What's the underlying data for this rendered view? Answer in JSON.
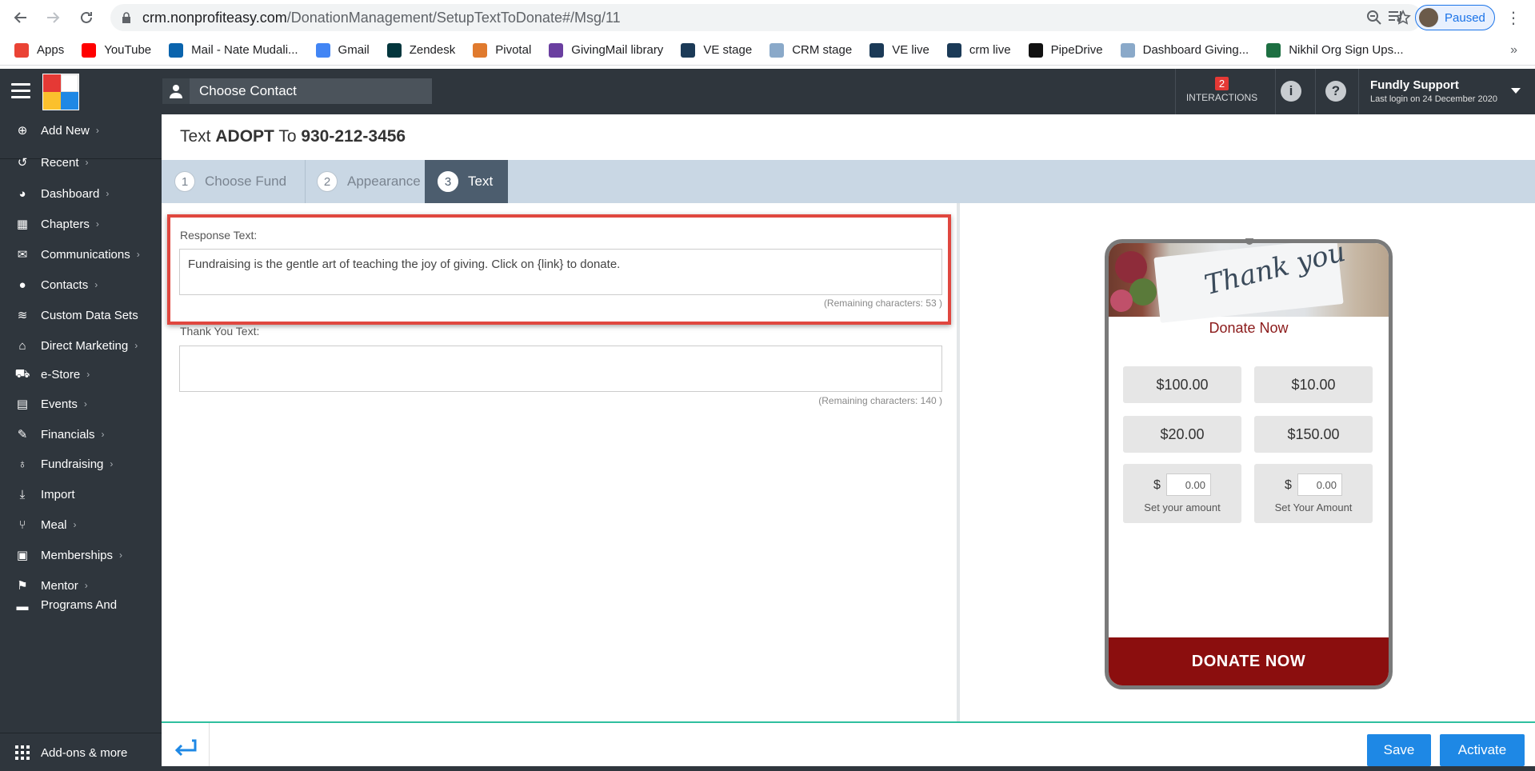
{
  "browser": {
    "url_host": "crm.nonprofiteasy.com",
    "url_path": "/DonationManagement/SetupTextToDonate#/Msg/11",
    "profile_status": "Paused"
  },
  "bookmarks": [
    {
      "label": "Apps",
      "icon": "apps-grid-icon",
      "color": "#ea4335"
    },
    {
      "label": "YouTube",
      "icon": "youtube-icon",
      "color": "#ff0000"
    },
    {
      "label": "Mail - Nate Mudali...",
      "icon": "outlook-icon",
      "color": "#0a64ad"
    },
    {
      "label": "Gmail",
      "icon": "google-icon",
      "color": "#4285f4"
    },
    {
      "label": "Zendesk",
      "icon": "zendesk-icon",
      "color": "#03363d"
    },
    {
      "label": "Pivotal",
      "icon": "pivotal-icon",
      "color": "#e07a2e"
    },
    {
      "label": "GivingMail library",
      "icon": "givingmail-icon",
      "color": "#6a3fa0"
    },
    {
      "label": "VE stage",
      "icon": "ve-icon",
      "color": "#1b3a57"
    },
    {
      "label": "CRM stage",
      "icon": "doc-icon",
      "color": "#8aa9c9"
    },
    {
      "label": "VE live",
      "icon": "ve-icon",
      "color": "#1b3a57"
    },
    {
      "label": "crm live",
      "icon": "ve-icon",
      "color": "#1b3a57"
    },
    {
      "label": "PipeDrive",
      "icon": "pipedrive-icon",
      "color": "#111111"
    },
    {
      "label": "Dashboard Giving...",
      "icon": "doc-icon",
      "color": "#8aa9c9"
    },
    {
      "label": "Nikhil Org Sign Ups...",
      "icon": "excel-icon",
      "color": "#1d6f42"
    }
  ],
  "header": {
    "choose_contact": "Choose Contact",
    "interactions_count": "2",
    "interactions_label": "INTERACTIONS",
    "user_name": "Fundly Support",
    "last_login": "Last login on 24 December 2020"
  },
  "sidebar": {
    "items": [
      {
        "label": "Add New",
        "icon": "plus-circle-icon"
      },
      {
        "label": "Recent",
        "icon": "history-icon"
      },
      {
        "label": "Dashboard",
        "icon": "palette-icon"
      },
      {
        "label": "Chapters",
        "icon": "grid-icon"
      },
      {
        "label": "Communications",
        "icon": "envelope-icon"
      },
      {
        "label": "Contacts",
        "icon": "user-icon"
      },
      {
        "label": "Custom Data Sets",
        "icon": "layers-icon"
      },
      {
        "label": "Direct Marketing",
        "icon": "building-icon"
      },
      {
        "label": "e-Store",
        "icon": "cart-icon"
      },
      {
        "label": "Events",
        "icon": "calendar-icon"
      },
      {
        "label": "Financials",
        "icon": "ticket-icon"
      },
      {
        "label": "Fundraising",
        "icon": "money-bag-icon"
      },
      {
        "label": "Import",
        "icon": "download-icon"
      },
      {
        "label": "Meal",
        "icon": "utensils-icon"
      },
      {
        "label": "Memberships",
        "icon": "id-card-icon"
      },
      {
        "label": "Mentor",
        "icon": "running-icon"
      },
      {
        "label": "Programs And",
        "icon": "folder-icon"
      }
    ],
    "addons": "Add-ons & more"
  },
  "page": {
    "title_prefix": "Text ",
    "keyword": "ADOPT",
    "title_mid": " To ",
    "phone_number": "930-212-3456"
  },
  "tabs": [
    {
      "num": "1",
      "label": "Choose Fund"
    },
    {
      "num": "2",
      "label": "Appearance"
    },
    {
      "num": "3",
      "label": "Text"
    }
  ],
  "form": {
    "response_label": "Response Text:",
    "response_value": "Fundraising is the gentle art of teaching the joy of giving. Click on {link} to donate.",
    "response_remaining": "(Remaining characters: 53 )",
    "thankyou_label": "Thank You Text:",
    "thankyou_value": "",
    "thankyou_remaining": "(Remaining characters: 140 )"
  },
  "preview": {
    "image_text": "Thank you",
    "donate_title": "Donate Now",
    "amounts": [
      "$100.00",
      "$10.00",
      "$20.00",
      "$150.00"
    ],
    "currency": "$",
    "custom_left_value": "0.00",
    "custom_left_caption": "Set your amount",
    "custom_right_value": "0.00",
    "custom_right_caption": "Set Your Amount",
    "donate_button": "DONATE NOW"
  },
  "footer": {
    "save": "Save",
    "activate": "Activate"
  }
}
